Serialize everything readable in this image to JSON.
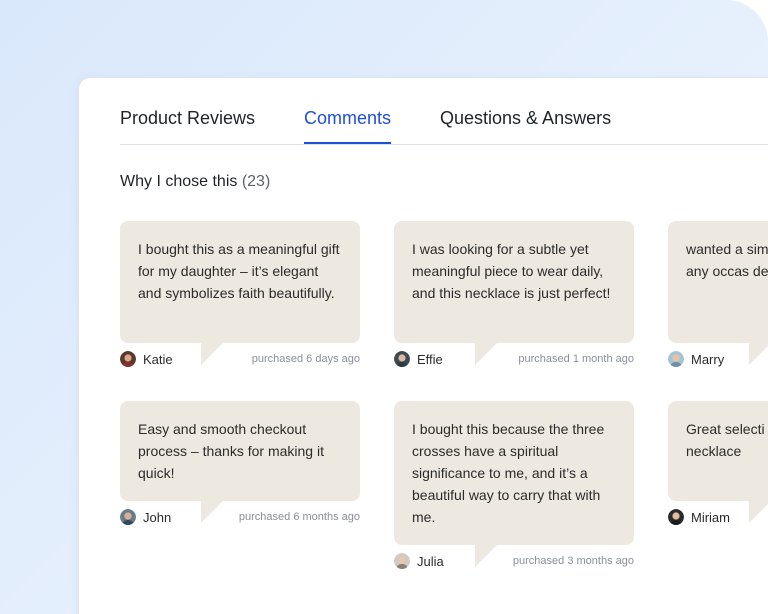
{
  "tabs": [
    {
      "label": "Product Reviews"
    },
    {
      "label": "Comments"
    },
    {
      "label": "Questions & Answers"
    }
  ],
  "section": {
    "title": "Why I chose this",
    "count": "(23)"
  },
  "reviews": [
    {
      "text": "I bought this as a meaningful gift for my daughter – it’s elegant and symbolizes faith beautifully.",
      "name": "Katie",
      "purchased": "purchased 6 days ago"
    },
    {
      "text": "I was looking for a subtle yet meaningful piece to wear daily, and this necklace is just perfect!",
      "name": "Effie",
      "purchased": "purchased 1 month ago"
    },
    {
      "text": "wanted a sim gold necklace for any occas design caugh",
      "name": "Marry",
      "purchased": ""
    },
    {
      "text": "Easy and smooth checkout process – thanks for making it quick!",
      "name": "John",
      "purchased": "purchased 6 months ago"
    },
    {
      "text": "I bought this because the three crosses have a spiritual significance to me, and it’s a beautiful way to carry that with me.",
      "name": "Julia",
      "purchased": "purchased 3 months ago"
    },
    {
      "text": "Great selecti checkout. Ca new necklace",
      "name": "Miriam",
      "purchased": ""
    }
  ],
  "colors": {
    "accent": "#1f4fd6",
    "bubble": "#ede9e1"
  }
}
